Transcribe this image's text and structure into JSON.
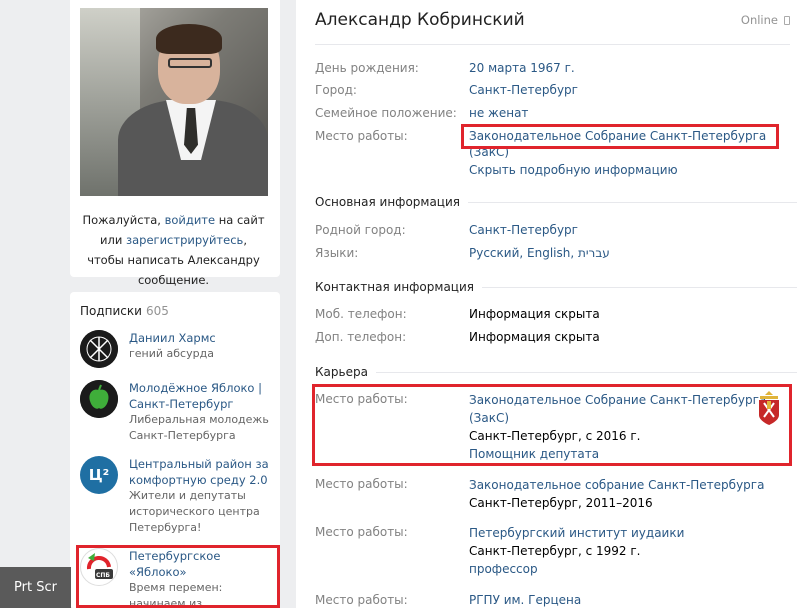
{
  "profile": {
    "name": "Александр Кобринский",
    "status": "Online",
    "login_msg": {
      "pre": "Пожалуйста, ",
      "login": "войдите",
      "mid": " на сайт или ",
      "register": "зарегистрируйтесь",
      "post": ", чтобы написать Александру сообщение."
    }
  },
  "short_info": [
    {
      "label": "День рождения:",
      "value": "20 марта 1967 г."
    },
    {
      "label": "Город:",
      "value": "Санкт-Петербург"
    },
    {
      "label": "Семейное положение:",
      "value": "не женат"
    },
    {
      "label": "Место работы:",
      "value": "Законодательное Собрание Санкт-Петербурга (ЗакС)"
    }
  ],
  "hide_link": "Скрыть подробную информацию",
  "main_info": {
    "title": "Основная информация",
    "rows": [
      {
        "label": "Родной город:",
        "value": "Санкт-Петербург"
      },
      {
        "label": "Языки:",
        "value": "Русский, English, עברית"
      }
    ]
  },
  "contact_info": {
    "title": "Контактная информация",
    "rows": [
      {
        "label": "Моб. телефон:",
        "value": "Информация скрыта"
      },
      {
        "label": "Доп. телефон:",
        "value": "Информация скрыта"
      }
    ]
  },
  "career": {
    "title": "Карьера",
    "jobs": [
      {
        "label": "Место работы:",
        "org_line1": "Законодательное Собрание Санкт-Петербурга",
        "org_line2": "(ЗакС)",
        "place": "Санкт-Петербург, с 2016 г.",
        "position": "Помощник депутата"
      },
      {
        "label": "Место работы:",
        "org": "Законодательное собрание Санкт-Петербурга",
        "place": "Санкт-Петербург, 2011–2016"
      },
      {
        "label": "Место работы:",
        "org": "Петербургский институт иудаики",
        "place": "Санкт-Петербург, с 1992 г.",
        "position": "профессор"
      },
      {
        "label": "Место работы:",
        "org": "РГПУ им. Герцена"
      }
    ]
  },
  "subscriptions": {
    "title": "Подписки",
    "count": "605",
    "items": [
      {
        "name": "Даниил Хармс",
        "desc": "гений абсурда",
        "color": "#1b1b1b",
        "icon": "kharms-logo-icon"
      },
      {
        "name": "Молодёжное Яблоко | Санкт-Петербург",
        "desc": "Либеральная молодежь Санкт-Петербурга",
        "color": "#1b1b1b",
        "icon": "green-apple-icon"
      },
      {
        "name": "Центральный район за комфортную среду 2.0",
        "desc": "Жители и депутаты исторического центра Петербурга!",
        "color": "#1f6fa3",
        "icon": "c2-logo-icon",
        "icon_text": "Ц²"
      },
      {
        "name": "Петербургское «Яблоко»",
        "desc": "Время перемен: начинаем из Петербурга!",
        "color": "#ffffff",
        "icon": "yabloko-spb-logo-icon",
        "icon_text": "СПБ"
      }
    ]
  },
  "overlay": {
    "prtscr": "Prt Scr"
  },
  "colors": {
    "highlight": "#e0242c",
    "link": "#2a5885",
    "label": "#828282"
  }
}
